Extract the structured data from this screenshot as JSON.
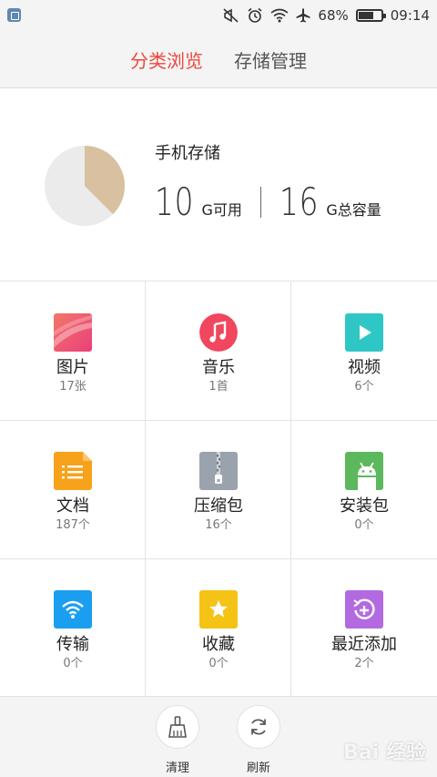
{
  "status_bar": {
    "battery_percent": "68%",
    "battery_level": 0.68,
    "time": "09:14",
    "icons": [
      "app-notification-icon",
      "mute-icon",
      "alarm-icon",
      "wifi-icon",
      "airplane-icon",
      "battery-icon"
    ]
  },
  "tabs": [
    {
      "label": "分类浏览",
      "active": true
    },
    {
      "label": "存储管理",
      "active": false
    }
  ],
  "storage": {
    "title": "手机存储",
    "available_value": "10",
    "available_unit": "G可用",
    "total_value": "16",
    "total_unit": "G总容量",
    "used_fraction": 0.375,
    "colors": {
      "used": "#d8c0a0",
      "free": "#ebebeb"
    }
  },
  "categories": [
    {
      "label": "图片",
      "count": "17张",
      "icon": "pictures-icon",
      "color": "#f0506a"
    },
    {
      "label": "音乐",
      "count": "1首",
      "icon": "music-icon",
      "color": "#f0465e"
    },
    {
      "label": "视频",
      "count": "6个",
      "icon": "video-icon",
      "color": "#2fc7c6"
    },
    {
      "label": "文档",
      "count": "187个",
      "icon": "document-icon",
      "color": "#f7a21b"
    },
    {
      "label": "压缩包",
      "count": "16个",
      "icon": "archive-icon",
      "color": "#9aa2ae"
    },
    {
      "label": "安装包",
      "count": "0个",
      "icon": "android-package-icon",
      "color": "#5cb85c"
    },
    {
      "label": "传输",
      "count": "0个",
      "icon": "transfer-wifi-icon",
      "color": "#1a9ef0"
    },
    {
      "label": "收藏",
      "count": "0个",
      "icon": "favorite-star-icon",
      "color": "#f5c316"
    },
    {
      "label": "最近添加",
      "count": "2个",
      "icon": "recent-added-icon",
      "color": "#b36ae0"
    }
  ],
  "bottom_bar": {
    "clean_label": "清理",
    "refresh_label": "刷新"
  },
  "watermark": "Bai 经验"
}
